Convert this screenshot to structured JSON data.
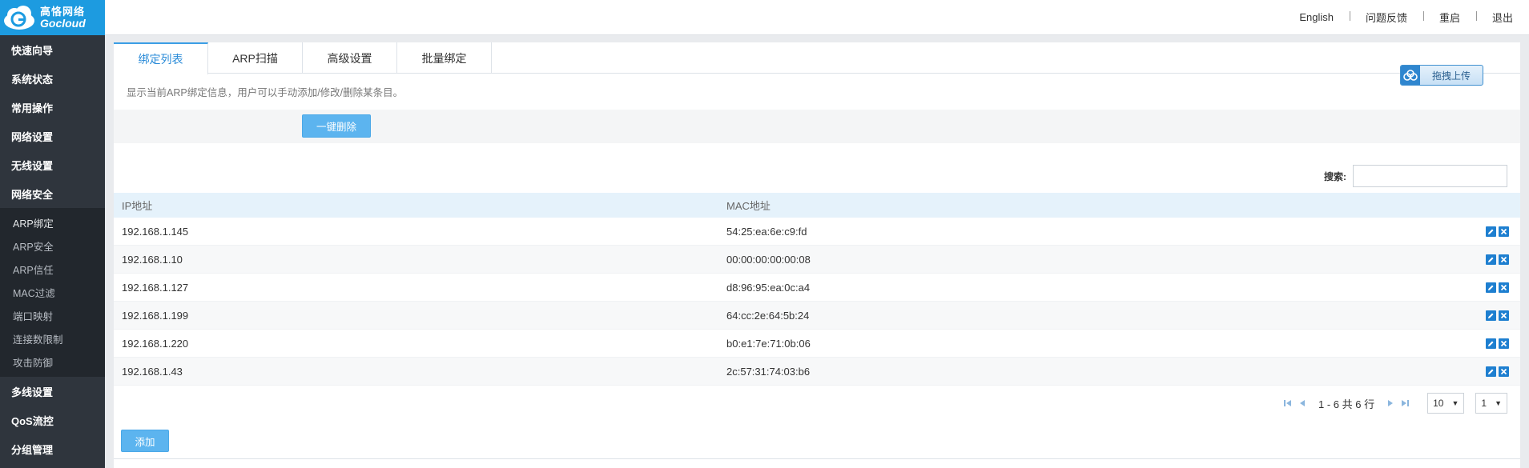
{
  "brand": {
    "name_cn": "高恪网络",
    "name_en": "Gocloud",
    "color": "#1d9be0"
  },
  "topbar": {
    "links": [
      "English",
      "问题反馈",
      "重启",
      "退出"
    ]
  },
  "sidebar": {
    "items_top": [
      "快速向导",
      "系统状态",
      "常用操作",
      "网络设置",
      "无线设置",
      "网络安全"
    ],
    "sub_items": [
      "ARP绑定",
      "ARP安全",
      "ARP信任",
      "MAC过滤",
      "端口映射",
      "连接数限制",
      "攻击防御"
    ],
    "items_bottom": [
      "多线设置",
      "QoS流控",
      "分组管理"
    ]
  },
  "tabs": [
    {
      "label": "绑定列表",
      "active": true
    },
    {
      "label": "ARP扫描",
      "active": false
    },
    {
      "label": "高级设置",
      "active": false
    },
    {
      "label": "批量绑定",
      "active": false
    }
  ],
  "upload_button": {
    "label": "拖拽上传",
    "icon": "cloud-icon"
  },
  "description": "显示当前ARP绑定信息，用户可以手动添加/修改/删除某条目。",
  "delete_all_button": "一键删除",
  "search": {
    "label": "搜索:",
    "value": ""
  },
  "table": {
    "headers": [
      "IP地址",
      "MAC地址"
    ],
    "rows": [
      {
        "ip": "192.168.1.145",
        "mac": "54:25:ea:6e:c9:fd"
      },
      {
        "ip": "192.168.1.10",
        "mac": "00:00:00:00:00:08"
      },
      {
        "ip": "192.168.1.127",
        "mac": "d8:96:95:ea:0c:a4"
      },
      {
        "ip": "192.168.1.199",
        "mac": "64:cc:2e:64:5b:24"
      },
      {
        "ip": "192.168.1.220",
        "mac": "b0:e1:7e:71:0b:06"
      },
      {
        "ip": "192.168.1.43",
        "mac": "2c:57:31:74:03:b6"
      }
    ],
    "row_actions": [
      "edit-icon",
      "delete-icon"
    ]
  },
  "pager": {
    "summary": "1 - 6 共 6 行",
    "page_size": "10",
    "page": "1"
  },
  "add_button": "添加"
}
